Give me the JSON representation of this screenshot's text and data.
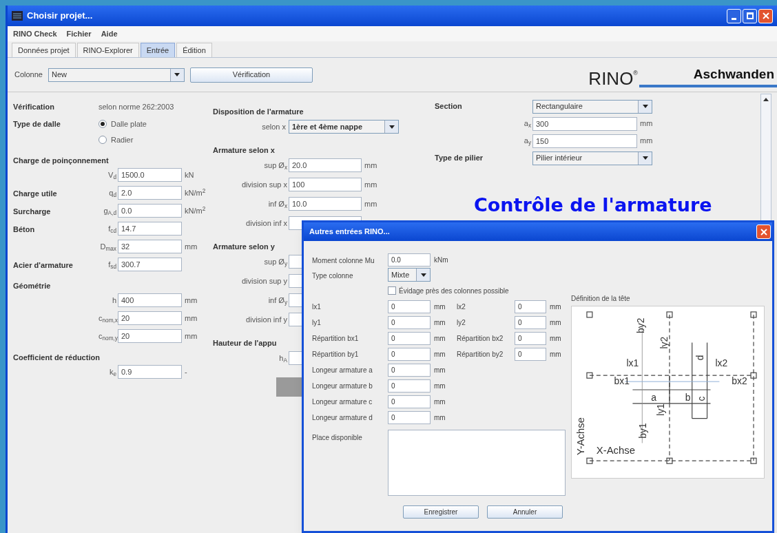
{
  "window": {
    "title": "Choisir projet..."
  },
  "menu": [
    "RINO Check",
    "Fichier",
    "Aide"
  ],
  "tabs": [
    {
      "label": "Données projet",
      "selected": false
    },
    {
      "label": "RINO-Explorer",
      "selected": false
    },
    {
      "label": "Entrée",
      "selected": true
    },
    {
      "label": "Édition",
      "selected": false
    }
  ],
  "toolbar": {
    "label": "Colonne",
    "value": "New",
    "button": "Vérification"
  },
  "logo": {
    "brand": "RINO",
    "mark": "®",
    "company": "Aschwanden"
  },
  "left": [
    {
      "kind": "pair",
      "label": "Vérification",
      "value": "selon norme 262:2003"
    },
    {
      "kind": "radio",
      "label": "Type de dalle",
      "options": [
        {
          "label": "Dalle plate",
          "selected": true
        },
        {
          "label": "Radier",
          "selected": false
        }
      ]
    },
    {
      "kind": "heading",
      "label": "Charge de poinçonnement"
    },
    {
      "kind": "field",
      "symbol": "V$_{d}$",
      "value": "1500.0",
      "unit": "kN"
    },
    {
      "kind": "field",
      "label": "Charge utile",
      "symbol": "q$_{d}$",
      "value": "2.0",
      "unit": "kN/m$^{2}$"
    },
    {
      "kind": "field",
      "label": "Surcharge",
      "symbol": "g$_{A,d}$",
      "value": "0.0",
      "unit": "kN/m$^{2}$"
    },
    {
      "kind": "field",
      "label": "Béton",
      "symbol": "f$_{cd}$",
      "value": "14.7"
    },
    {
      "kind": "field",
      "symbol": "D$_{max}$",
      "value": "32",
      "unit": "mm"
    },
    {
      "kind": "field",
      "label": "Acier d'armature",
      "symbol": "f$_{sd}$",
      "value": "300.7"
    },
    {
      "kind": "heading",
      "label": "Géométrie"
    },
    {
      "kind": "field",
      "symbol": "h",
      "value": "400",
      "unit": "mm"
    },
    {
      "kind": "field",
      "symbol": "c$_{nom,x}$",
      "value": "20",
      "unit": "mm"
    },
    {
      "kind": "field",
      "symbol": "c$_{nom,y}$",
      "value": "20",
      "unit": "mm"
    },
    {
      "kind": "heading",
      "label": "Coefficient de réduction"
    },
    {
      "kind": "field",
      "symbol": "k$_{e}$",
      "value": "0.9",
      "unit": "-"
    }
  ],
  "middle": [
    {
      "kind": "heading",
      "label": "Disposition de l'armature"
    },
    {
      "kind": "select",
      "symbol": "selon x",
      "value": "1ère et 4ème nappe"
    },
    {
      "kind": "heading",
      "label": "Armature selon x"
    },
    {
      "kind": "field",
      "symbol": "sup Ø$_{x}$",
      "value": "20.0",
      "unit": "mm"
    },
    {
      "kind": "field",
      "symbol": "division sup x",
      "value": "100",
      "unit": "mm"
    },
    {
      "kind": "field",
      "symbol": "inf Ø$_{x}$",
      "value": "10.0",
      "unit": "mm"
    },
    {
      "kind": "field",
      "symbol": "division inf x"
    },
    {
      "kind": "heading",
      "label": "Armature selon y"
    },
    {
      "kind": "field",
      "symbol": "sup Ø$_{y}$"
    },
    {
      "kind": "field",
      "symbol": "division sup y"
    },
    {
      "kind": "field",
      "symbol": "inf Ø$_{y}$"
    },
    {
      "kind": "field",
      "symbol": "division inf y"
    },
    {
      "kind": "heading",
      "label": "Hauteur de l'appu"
    },
    {
      "kind": "field",
      "symbol": "h$_{A}$"
    }
  ],
  "right": [
    {
      "kind": "select",
      "label": "Section",
      "value": "Rectangulaire"
    },
    {
      "kind": "field",
      "symbol": "a$_{x}$",
      "value": "300",
      "unit": "mm"
    },
    {
      "kind": "field",
      "symbol": "a$_{y}$",
      "value": "150",
      "unit": "mm"
    },
    {
      "kind": "select",
      "label": "Type de pilier",
      "value": "Pilier intérieur"
    }
  ],
  "caption": "Contrôle de l'armature",
  "dialog": {
    "title": "Autres entrées RINO...",
    "moment": {
      "label": "Moment colonne Mu",
      "value": "0.0",
      "unit": "kNm"
    },
    "type": {
      "label": "Type colonne",
      "value": "Mixte"
    },
    "checkbox": {
      "label": "Évidage près des colonnes possible",
      "checked": false
    },
    "grid": [
      {
        "left": {
          "label": "lx1",
          "value": "0",
          "unit": "mm"
        },
        "right": {
          "label": "lx2",
          "value": "0",
          "unit": "mm"
        }
      },
      {
        "left": {
          "label": "ly1",
          "value": "0",
          "unit": "mm"
        },
        "right": {
          "label": "ly2",
          "value": "0",
          "unit": "mm"
        }
      },
      {
        "left": {
          "label": "Répartition bx1",
          "value": "0",
          "unit": "mm"
        },
        "right": {
          "label": "Répartition bx2",
          "value": "0",
          "unit": "mm"
        }
      },
      {
        "left": {
          "label": "Répartition by1",
          "value": "0",
          "unit": "mm"
        },
        "right": {
          "label": "Répartition by2",
          "value": "0",
          "unit": "mm"
        }
      },
      {
        "left": {
          "label": "Longeur armature a",
          "value": "0",
          "unit": "mm"
        }
      },
      {
        "left": {
          "label": "Longeur armature b",
          "value": "0",
          "unit": "mm"
        }
      },
      {
        "left": {
          "label": "Longeur armature c",
          "value": "0",
          "unit": "mm"
        }
      },
      {
        "left": {
          "label": "Longeur armature d",
          "value": "0",
          "unit": "mm"
        }
      }
    ],
    "place": {
      "label": "Place disponible"
    },
    "diagram": {
      "title": "Définition de la tête",
      "labels": [
        "by2",
        "ly2",
        "lx1",
        "d",
        "lx2",
        "bx1",
        "bx2",
        "a",
        "b",
        "c",
        "ly1",
        "by1",
        "Y-Achse",
        "X-Achse"
      ]
    },
    "buttons": [
      "Enregistrer",
      "Annuler"
    ]
  }
}
